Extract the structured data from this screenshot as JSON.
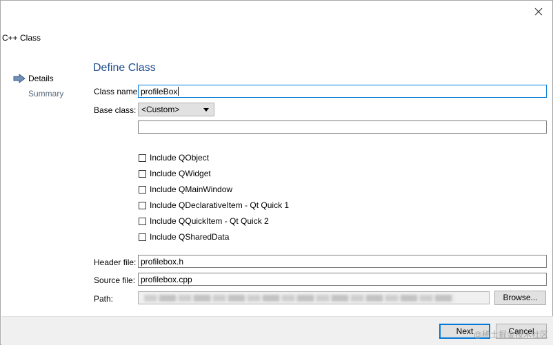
{
  "window": {
    "title": "C++ Class"
  },
  "sidebar": {
    "items": [
      {
        "label": "Details"
      },
      {
        "label": "Summary"
      }
    ]
  },
  "page": {
    "section_title": "Define Class"
  },
  "form": {
    "class_name_label": "Class name:",
    "class_name_value": "profileBox",
    "base_class_label": "Base class:",
    "base_class_value": "<Custom>",
    "custom_base_value": "",
    "checkboxes": [
      {
        "label": "Include QObject",
        "checked": false
      },
      {
        "label": "Include QWidget",
        "checked": false
      },
      {
        "label": "Include QMainWindow",
        "checked": false
      },
      {
        "label": "Include QDeclarativeItem - Qt Quick 1",
        "checked": false
      },
      {
        "label": "Include QQuickItem - Qt Quick 2",
        "checked": false
      },
      {
        "label": "Include QSharedData",
        "checked": false
      }
    ],
    "header_file_label": "Header file:",
    "header_file_value": "profilebox.h",
    "source_file_label": "Source file:",
    "source_file_value": "profilebox.cpp",
    "path_label": "Path:",
    "browse_label": "Browse..."
  },
  "footer": {
    "next_label": "Next",
    "cancel_label": "Cancel"
  },
  "watermark": "@稀土掘金技术社区",
  "colors": {
    "accent": "#0078d7",
    "title": "#1e4e8c",
    "footer_bg": "#f0f0f0"
  },
  "icons": {
    "close": "close-icon",
    "arrow": "arrow-right-icon"
  }
}
